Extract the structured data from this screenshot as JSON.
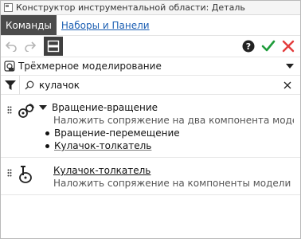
{
  "window": {
    "title": "Конструктор инструментальной области: Деталь"
  },
  "tabs": [
    {
      "label": "Команды",
      "active": true
    },
    {
      "label": "Наборы и Панели",
      "active": false
    }
  ],
  "toolbar": {
    "undo_icon": "undo-arrow-icon",
    "redo_icon": "redo-arrow-icon",
    "panel_icon": "panel-toggle-icon",
    "help_icon": "help-question-icon",
    "ok_icon": "checkmark-icon",
    "cancel_icon": "close-x-icon",
    "colors": {
      "ok": "#1e9c3a",
      "cancel": "#e33b3b",
      "panel": "#3f3f3f"
    }
  },
  "workspace_dropdown": {
    "selected": "Трёхмерное моделирование"
  },
  "search": {
    "value": "кулачок"
  },
  "results": [
    {
      "title": "Вращение-вращение",
      "description": "Наложить сопряжение на два компонента модели...",
      "expanded": true,
      "children": [
        "Вращение-перемещение",
        "Кулачок-толкатель"
      ]
    },
    {
      "title": "Кулачок-толкатель",
      "description": "Наложить сопряжение на компоненты модели для..."
    }
  ]
}
